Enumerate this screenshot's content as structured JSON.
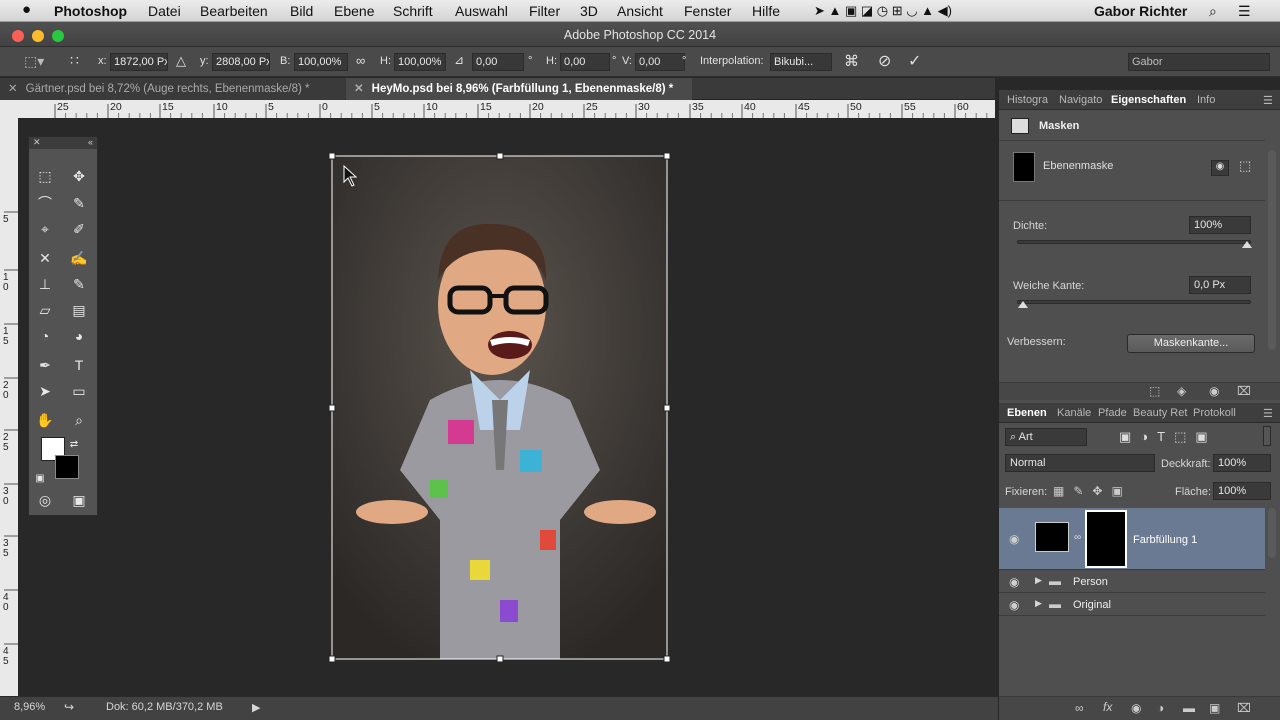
{
  "menubar": {
    "apple": "",
    "app": "Photoshop",
    "items": [
      "Datei",
      "Bearbeiten",
      "Bild",
      "Ebene",
      "Schrift",
      "Auswahl",
      "Filter",
      "3D",
      "Ansicht",
      "Fenster",
      "Hilfe"
    ],
    "user": "Gabor Richter"
  },
  "window": {
    "title": "Adobe Photoshop CC 2014"
  },
  "options": {
    "x_label": "x:",
    "x_value": "1872,00 Px",
    "y_label": "y:",
    "y_value": "2808,00 Px",
    "b_label": "B:",
    "b_value": "100,00%",
    "h_label": "H:",
    "h_value": "100,00%",
    "angle_value": "0,00",
    "deg": "°",
    "hskew_label": "H:",
    "hskew_value": "0,00",
    "vskew_label": "V:",
    "vskew_value": "0,00",
    "interp_label": "Interpolation:",
    "interp_value": "Bikubi...",
    "workspace": "Gabor"
  },
  "tabs": [
    {
      "label": "Gärtner.psd bei 8,72% (Auge rechts, Ebenenmaske/8) *",
      "active": false
    },
    {
      "label": "HeyMo.psd bei 8,96% (Farbfüllung 1, Ebenenmaske/8) *",
      "active": true
    }
  ],
  "ruler": {
    "h_ticks": [
      "25",
      "20",
      "15",
      "10",
      "5",
      "0",
      "5",
      "10",
      "15",
      "20",
      "25",
      "30",
      "35",
      "40",
      "45",
      "50",
      "55",
      "60"
    ],
    "v_ticks": [
      "5",
      "1\n0",
      "1\n5",
      "2\n0",
      "2\n5",
      "3\n0",
      "3\n5",
      "4\n0",
      "4\n5"
    ]
  },
  "status": {
    "zoom": "8,96%",
    "doc": "Dok: 60,2 MB/370,2 MB"
  },
  "props": {
    "tabs": [
      "Histogra",
      "Navigato",
      "Eigenschaften",
      "Info"
    ],
    "section": "Masken",
    "mask_name": "Ebenenmaske",
    "density_label": "Dichte:",
    "density_value": "100%",
    "density": 1.0,
    "feather_label": "Weiche Kante:",
    "feather_value": "0,0 Px",
    "feather": 0.0,
    "refine_label": "Verbessern:",
    "refine_button": "Maskenkante..."
  },
  "layers": {
    "tabs": [
      "Ebenen",
      "Kanäle",
      "Pfade",
      "Beauty Ret",
      "Protokoll"
    ],
    "filter": "Art",
    "blend": "Normal",
    "opacity_label": "Deckkraft:",
    "opacity_value": "100%",
    "lock_label": "Fixieren:",
    "fill_label": "Fläche:",
    "fill_value": "100%",
    "items": [
      {
        "name": "Farbfüllung 1",
        "selected": true
      },
      {
        "name": "Person",
        "selected": false
      },
      {
        "name": "Original",
        "selected": false
      }
    ]
  },
  "colors": {
    "accent": "#6b7a93",
    "panel": "#4f4f4f",
    "canvas": "#282828"
  }
}
